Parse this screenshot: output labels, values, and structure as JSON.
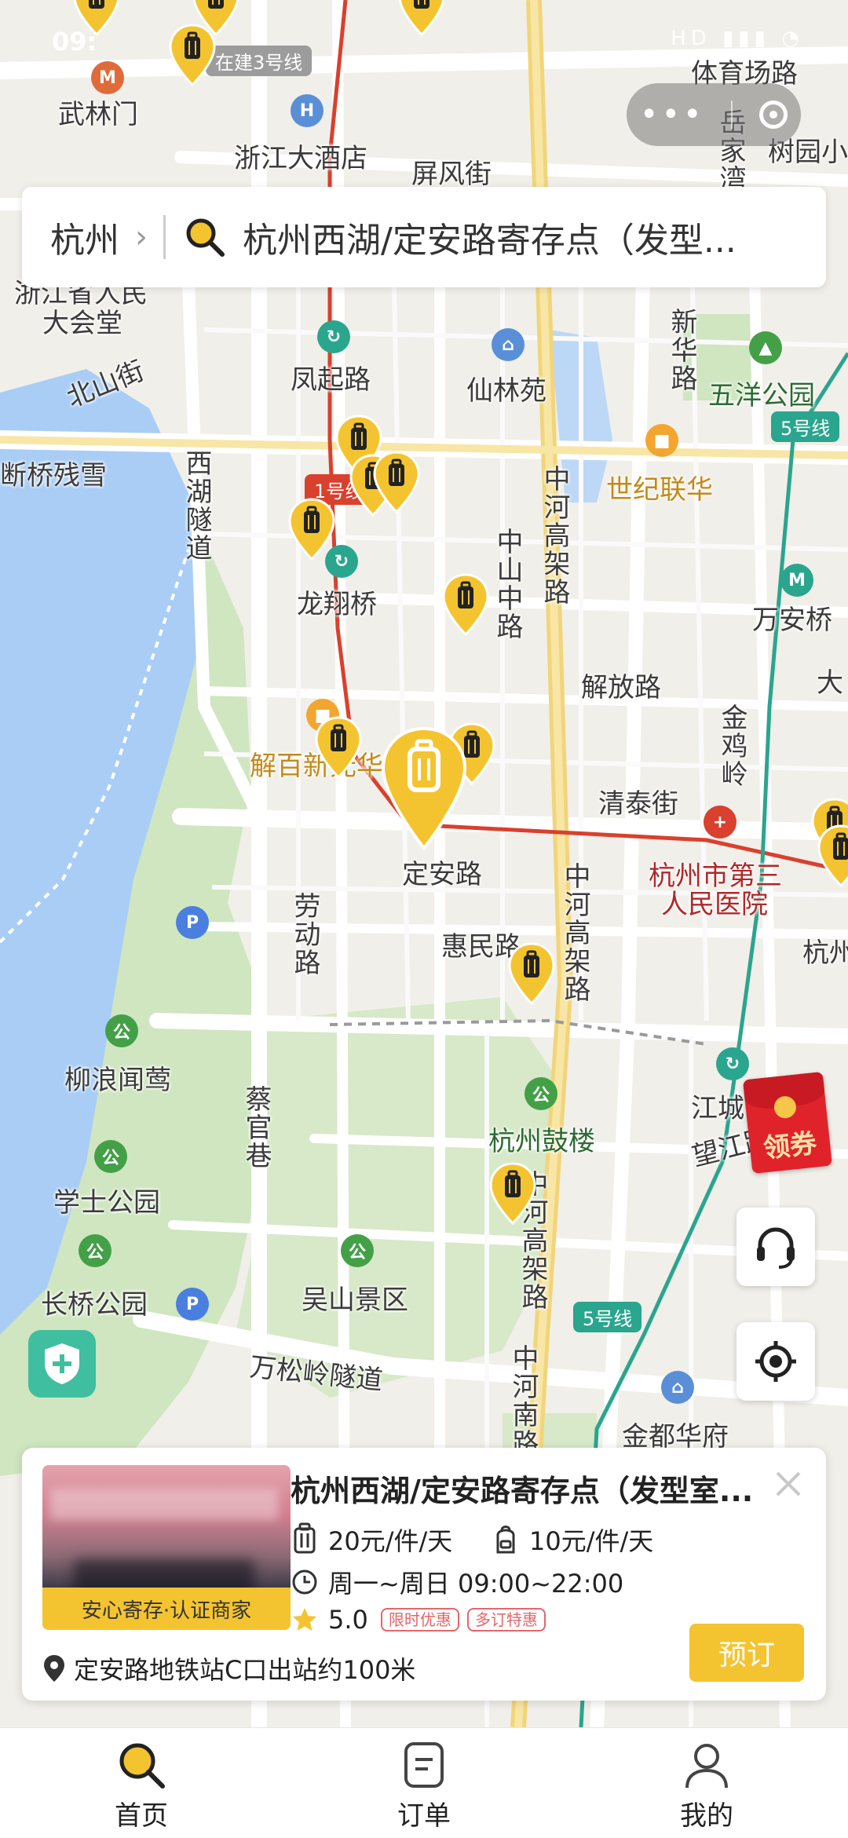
{
  "status_bar": {
    "time": "09:",
    "icons_text": "HD ▮▮▮ ◔"
  },
  "map": {
    "metro_badges": {
      "line3": "在建3号线",
      "line1": "1号线",
      "line5_top": "5号线",
      "line5_bottom": "5号线"
    },
    "labels": {
      "wulinmen": "武林门",
      "zhejiang_hotel": "浙江大酒店",
      "pingfeng": "屏风街",
      "tiyuchang": "体育场路",
      "yuejiawan": "岳家湾",
      "shuyuan": "树园小",
      "dahuitang_1": "浙江省人民",
      "dahuitang_2": "大会堂",
      "fengqi": "凤起路",
      "xianlinyuan": "仙林苑",
      "xinhua": "新华路",
      "wuyang": "五洋公园",
      "beishan": "北山街",
      "canxue": "断桥残雪",
      "xihu_tunnel": "西湖隧道",
      "shiji": "世纪联华",
      "longxiang": "龙翔桥",
      "zhongshan": "中山中路",
      "zhonghe_upper": "中河高架路",
      "wanan": "万安桥",
      "jiefang": "解放路",
      "jinji": "金鸡岭",
      "jiebai": "解百新元华",
      "qingtai": "清泰街",
      "dinganlu": "定安路",
      "hospital_1": "杭州市第三",
      "hospital_2": "人民医院",
      "hangzhou_right": "杭州",
      "laodong": "劳动路",
      "huimin": "惠民路",
      "zhonghe_mid": "中河高架路",
      "liulang": "柳浪闻莺",
      "caiguan": "蔡官巷",
      "jiangcheng": "江城",
      "wangjiang": "望江路",
      "gulou": "杭州鼓楼",
      "xueshi": "学士公园",
      "zhonghe_lower": "中河高架路",
      "wushan": "吴山景区",
      "changqiao": "长桥公园",
      "wansong": "万松岭隧道",
      "zhonghe_south": "中河南路",
      "jindu": "金都华府",
      "da": "大"
    }
  },
  "capsule": {
    "dots": "•••"
  },
  "search": {
    "city": "杭州",
    "chevron": "›",
    "query": "杭州西湖/定安路寄存点（发型..."
  },
  "coupon": {
    "label": "领券"
  },
  "card": {
    "badge": "安心寄存·认证商家",
    "title": "杭州西湖/定安路寄存点（发型室...",
    "price_large": "20元/件/天",
    "price_small": "10元/件/天",
    "hours": "周一~周日 09:00~22:00",
    "rating": "5.0",
    "tag1": "限时优惠",
    "tag2": "多订特惠",
    "address": "定安路地铁站C口出站约100米",
    "book_label": "预订"
  },
  "tabbar": {
    "home": "首页",
    "orders": "订单",
    "mine": "我的"
  },
  "colors": {
    "accent": "#f4c430",
    "water": "#a9cdf5",
    "park": "#cfe6c0",
    "metro_red": "#d9402e",
    "metro_teal": "#2aa58e"
  },
  "icons": [
    "search-icon",
    "chevron-right-icon",
    "luggage-pin-icon",
    "headset-icon",
    "locate-icon",
    "shield-plus-icon",
    "close-icon",
    "suitcase-icon",
    "backpack-icon",
    "clock-icon",
    "star-icon",
    "location-pin-icon",
    "order-icon",
    "user-icon"
  ]
}
